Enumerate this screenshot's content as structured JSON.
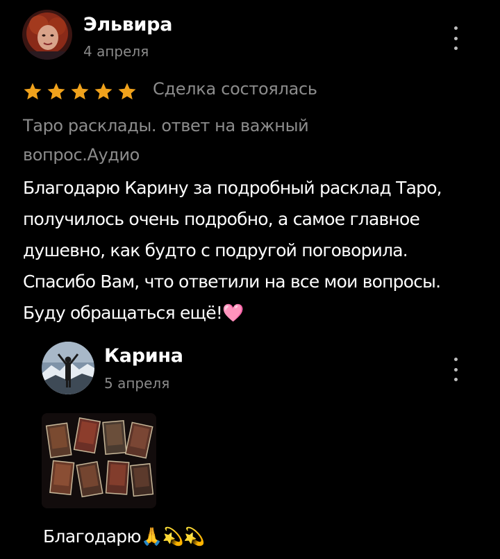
{
  "review": {
    "author": "Эльвира",
    "date": "4 апреля",
    "rating": 5,
    "status": "Сделка состоялась",
    "service": "Таро расклады. ответ на важный вопрос.Аудио",
    "text": "Благодарю Карину за подробный расклад Таро, получилось очень подробно, а самое главное душевно, как будто с подругой поговорила. Спасибо Вам, что ответили на все мои вопросы. Буду обращаться ещё!🩷"
  },
  "reply": {
    "author": "Карина",
    "date": "5 апреля",
    "text": "Благодарю🙏💫💫"
  },
  "icons": {
    "star": "star-icon",
    "menu": "more-vertical-icon",
    "heart": "pink-heart-emoji"
  },
  "colors": {
    "background": "#000000",
    "star": "#f0a21c",
    "muted": "#8c8c8c",
    "text": "#ffffff"
  }
}
